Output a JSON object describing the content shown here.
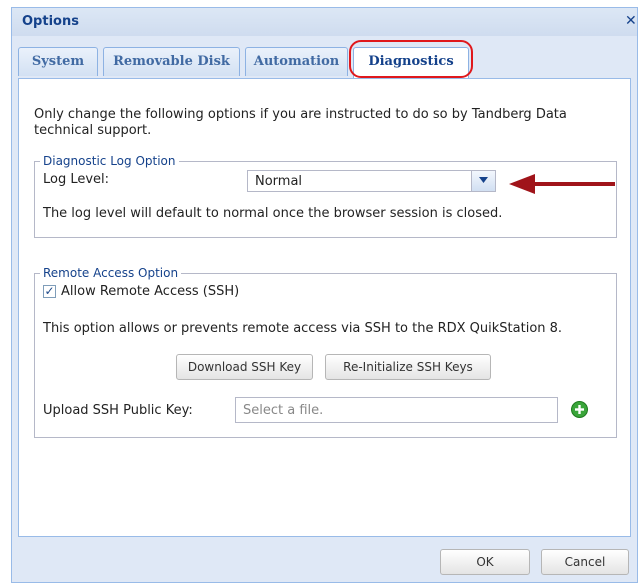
{
  "window": {
    "title": "Options",
    "close_glyph": "✕"
  },
  "tabs": [
    {
      "label": "System",
      "active": false
    },
    {
      "label": "Removable Disk",
      "active": false
    },
    {
      "label": "Automation",
      "active": false
    },
    {
      "label": "Diagnostics",
      "active": true
    }
  ],
  "intro_text": "Only change the following options if you are instructed to do so by Tandberg Data technical support.",
  "diagnostic_log": {
    "legend": "Diagnostic Log Option",
    "log_level_label": "Log Level:",
    "log_level_value": "Normal",
    "note": "The log level will default to normal once the browser session is closed."
  },
  "remote_access": {
    "legend": "Remote Access Option",
    "allow_checked": true,
    "allow_label": "Allow Remote Access (SSH)",
    "description": "This option allows or prevents remote access via SSH to the RDX QuikStation 8.",
    "download_button": "Download SSH Key",
    "reinit_button": "Re-Initialize SSH Keys",
    "upload_label": "Upload SSH Public Key:",
    "upload_placeholder": "Select a file."
  },
  "footer": {
    "ok": "OK",
    "cancel": "Cancel"
  },
  "icons": {
    "combo_trigger": "chevron-down-icon",
    "add": "add-file-icon",
    "close": "close-icon"
  },
  "colors": {
    "title": "#15428b",
    "highlight": "#e0181c",
    "arrow": "#a0141a",
    "add_icon": "#3aa53a"
  }
}
